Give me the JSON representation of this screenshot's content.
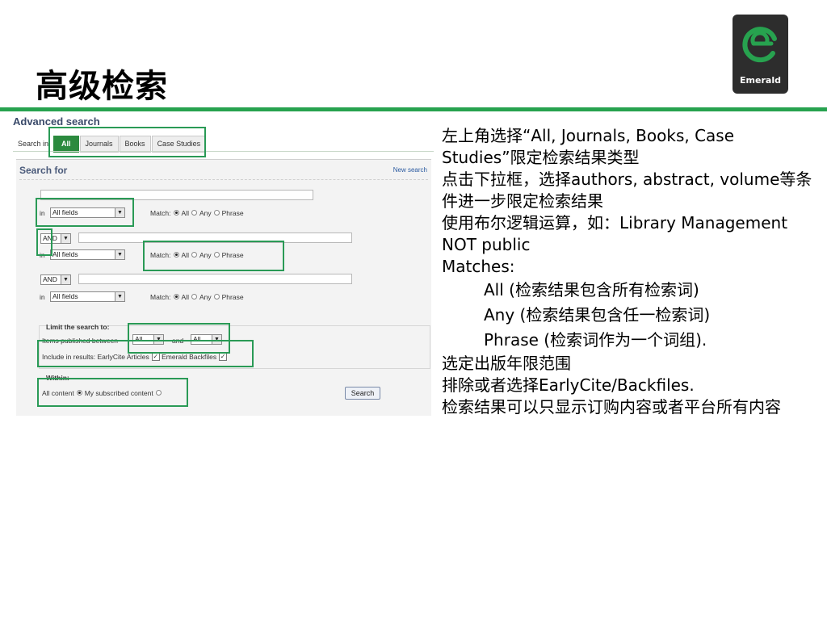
{
  "slide": {
    "title": "高级检索",
    "logo_text": "Emerald",
    "accent_color": "#27a24f"
  },
  "screenshot": {
    "heading": "Advanced search",
    "search_in_label": "Search in",
    "tabs": [
      {
        "label": "All",
        "active": true
      },
      {
        "label": "Journals",
        "active": false
      },
      {
        "label": "Books",
        "active": false
      },
      {
        "label": "Case Studies",
        "active": false
      }
    ],
    "search_for": "Search for",
    "new_search": "New search",
    "in_label": "in",
    "field_select": "All fields",
    "operator": "AND",
    "match_label": "Match:",
    "match_all": "All",
    "match_any": "Any",
    "match_phrase": "Phrase",
    "limit_heading": "Limit the search to:",
    "items_published_between": "Items published between",
    "year_from": "All",
    "and_label": "and",
    "year_to": "All",
    "include_label": "Include in results: EarlyCite Articles",
    "emerald_backfiles": "Emerald Backfiles",
    "within_label": "Within:",
    "all_content": "All content",
    "my_subscribed": "My subscribed content",
    "search_button": "Search"
  },
  "notes": {
    "line1": "左上角选择“All, Journals, Books, Case Studies”限定检索结果类型",
    "line2": "点击下拉框，选择authors, abstract, volume等条件进一步限定检索结果",
    "line3": "使用布尔逻辑运算，如：Library Management NOT public",
    "line4": "Matches:",
    "match_all": "All (检索结果包含所有检索词)",
    "match_any": "Any (检索结果包含任一检索词)",
    "match_phrase": "Phrase (检索词作为一个词组).",
    "line5": "选定出版年限范围",
    "line6": "排除或者选择EarlyCite/Backfiles.",
    "line7": "检索结果可以只显示订购内容或者平台所有内容"
  }
}
